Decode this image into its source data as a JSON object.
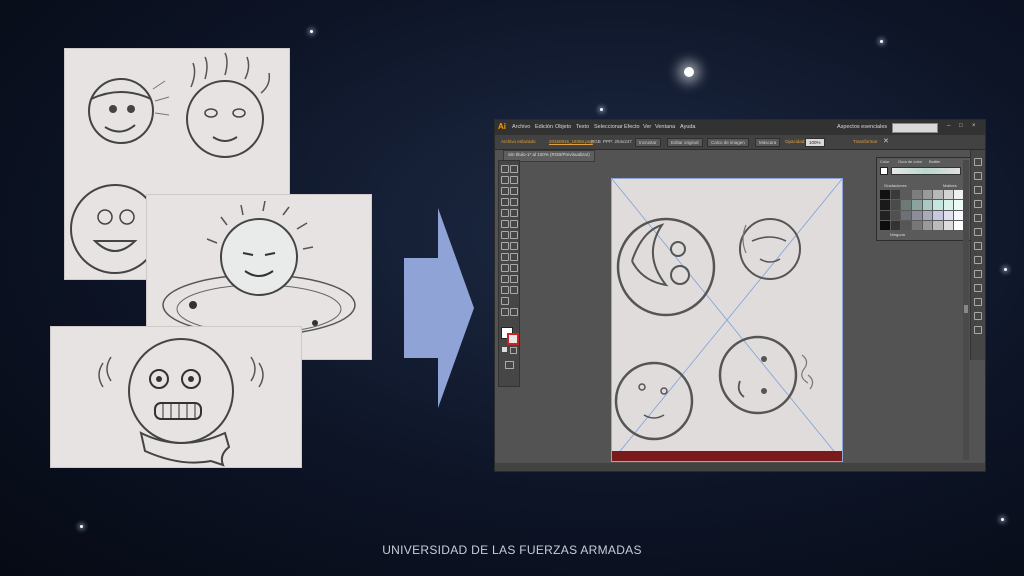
{
  "slide": {
    "footer": "UNIVERSIDAD DE LAS FUERZAS ARMADAS"
  },
  "illustrator": {
    "logo": "Ai",
    "menu": [
      "Archivo",
      "Edición",
      "Objeto",
      "Texto",
      "Seleccionar",
      "Efecto",
      "Ver",
      "Ventana",
      "Ayuda"
    ],
    "workspace": "Aspectos esenciales",
    "control_bar": {
      "object_label": "Archivo enlazado",
      "file_name": "20160815_18355.png",
      "color_mode": "RGB",
      "ppp": "PPP: 254x247",
      "buttons": [
        "Incrustar",
        "Editar original",
        "Calco de imagen",
        "Máscara"
      ],
      "opacity_label": "Opacidad:",
      "opacity_value": "100%",
      "transform_label": "Transformar"
    },
    "document_tab": "Sin título-1* al 100% (RGB/Previsualizar)",
    "panel": {
      "tabs": [
        "Color",
        "Guía de color",
        "Buttler"
      ],
      "gradaciones": "Gradaciones",
      "matices": "Matices",
      "ninguna": "Ninguna",
      "swatch_colors": [
        "#111111",
        "#3a3a3a",
        "#5c5c5c",
        "#7d7d7d",
        "#9a9a9a",
        "#b8b8b8",
        "#d3d3d3",
        "#f0f0f0",
        "#1a1a1a",
        "#4a4a4a",
        "#6e7a78",
        "#8aa39e",
        "#a7c9c2",
        "#c4e6dd",
        "#d9f2ec",
        "#eefaf6",
        "#222222",
        "#505050",
        "#6f6f76",
        "#8d8d99",
        "#a9a9bb",
        "#c7c7dd",
        "#e0e0ee",
        "#f7f7ff",
        "#0d0d0d",
        "#333333",
        "#565656",
        "#777777",
        "#999999",
        "#bbbbbb",
        "#dddddd",
        "#ffffff"
      ]
    }
  }
}
